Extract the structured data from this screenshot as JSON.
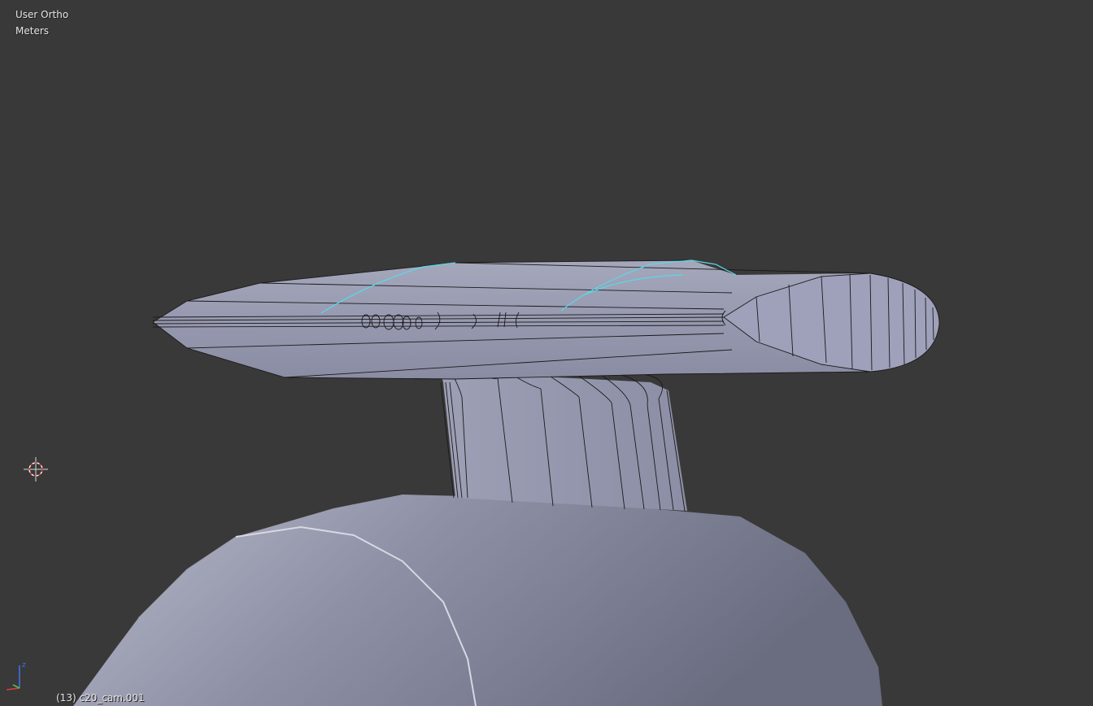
{
  "viewport": {
    "view_name": "User Ortho",
    "unit_name": "Meters",
    "object_info": "(13) c20_cam.001",
    "background_color": "#393939",
    "mesh_color": "#8f91aa",
    "selected_edge_color": "#5ad8e6"
  },
  "gizmo": {
    "axes": [
      "z",
      "x",
      "y"
    ],
    "x_color": "#d84040",
    "y_color": "#5ac040",
    "z_color": "#4070e0"
  },
  "icons": {
    "cursor": "3d-cursor-icon",
    "gizmo": "axis-gizmo-icon"
  }
}
